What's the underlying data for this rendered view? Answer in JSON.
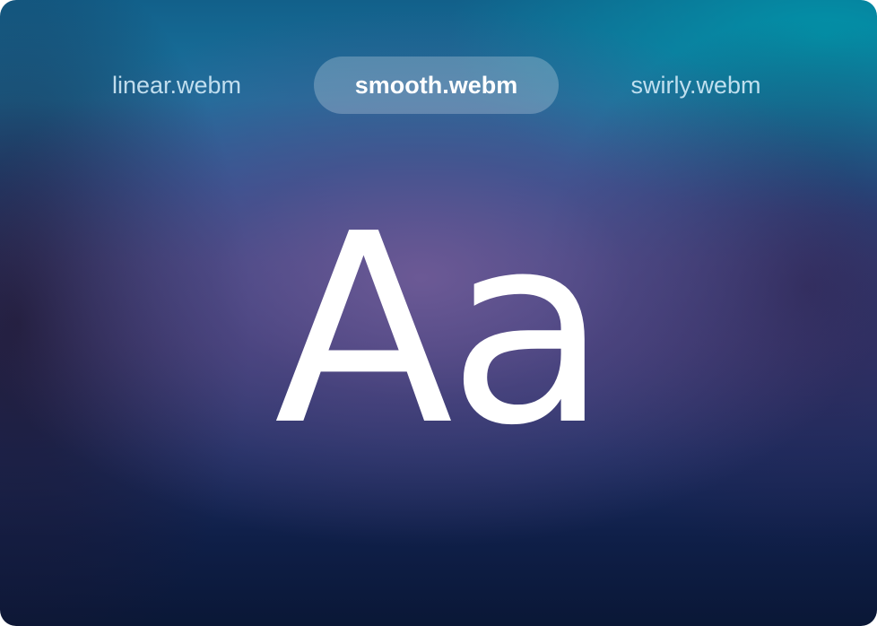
{
  "tabs": [
    {
      "label": "linear.webm",
      "selected": false
    },
    {
      "label": "smooth.webm",
      "selected": true
    },
    {
      "label": "swirly.webm",
      "selected": false
    }
  ],
  "preview": {
    "sample_text": "Aa"
  },
  "colors": {
    "text": "#ffffff",
    "selected_tab_bg": "rgba(255,255,255,0.24)",
    "top_teal": "#1a74a0",
    "center_purple": "#6e5a96",
    "bottom_navy": "#0a1736"
  }
}
